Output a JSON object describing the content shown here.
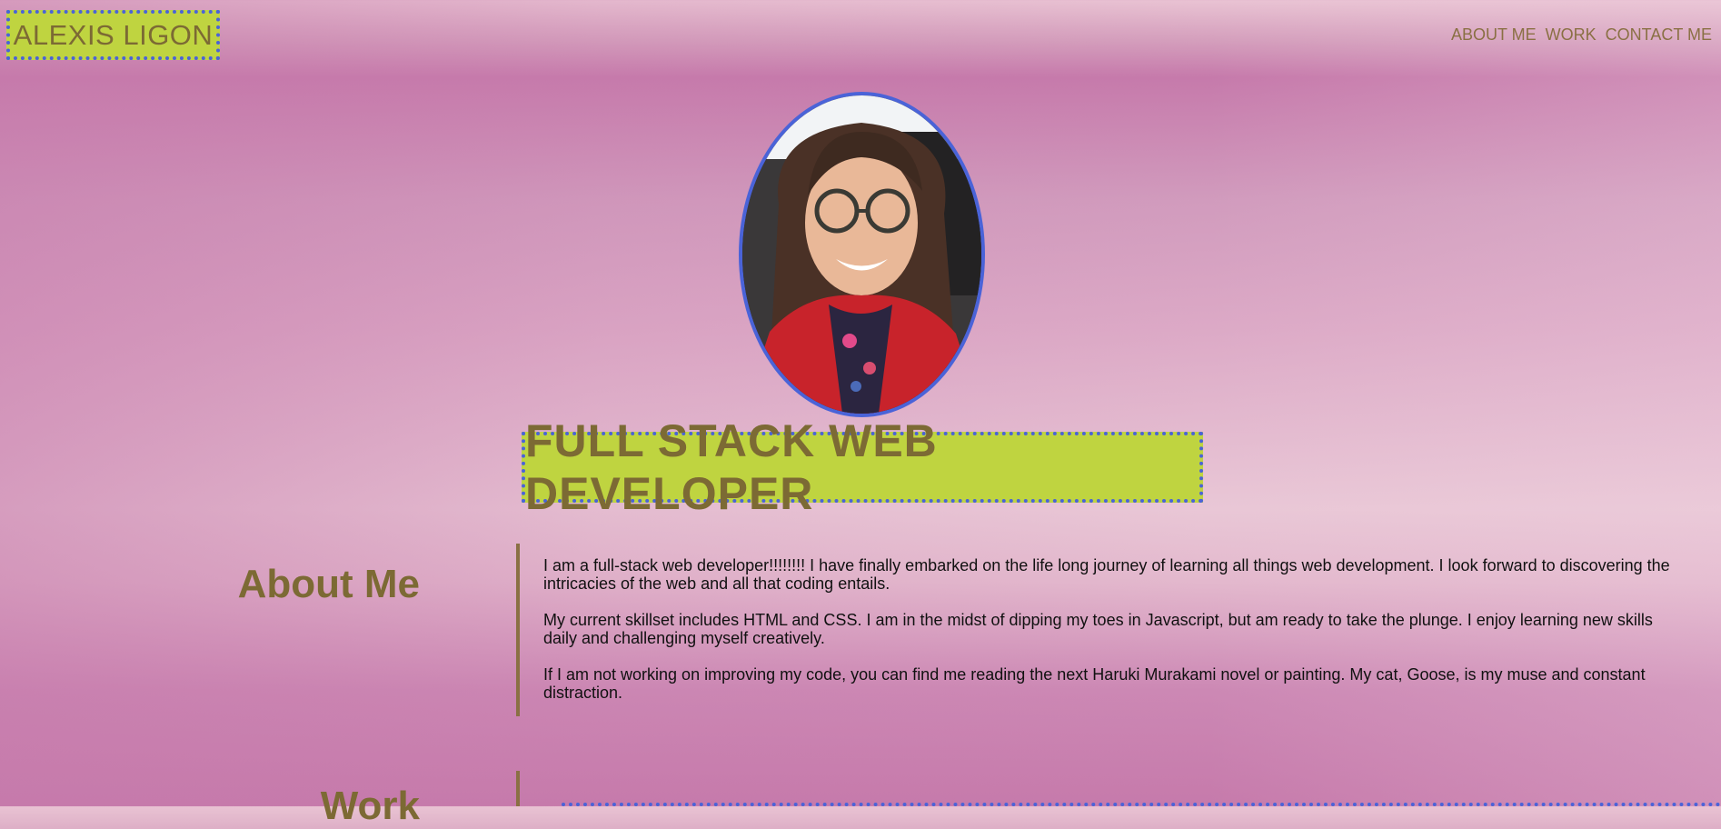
{
  "header": {
    "logo_text": "ALEXIS LIGON",
    "nav": [
      "ABOUT ME",
      "WORK",
      "CONTACT ME"
    ]
  },
  "hero": {
    "headline": "FULL STACK WEB DEVELOPER"
  },
  "about": {
    "title": "About Me",
    "paragraphs": [
      "I am a full-stack web developer!!!!!!!! I have finally embarked on the life long journey of learning all things web development. I look forward to discovering the intricacies of the web and all that coding entails.",
      "My current skillset includes HTML and CSS. I am in the midst of dipping my toes in Javascript, but am ready to take the plunge. I enjoy learning new skills daily and challenging myself creatively.",
      "If I am not working on improving my code, you can find me reading the next Haruki Murakami novel or painting. My cat, Goose, is my muse and constant distraction."
    ]
  },
  "work": {
    "title": "Work"
  },
  "colors": {
    "accent_green": "#bfd440",
    "dotted_border_blue": "#4a63d8",
    "heading_brown": "#7c6a34",
    "nav_brown": "#8a7044",
    "background_pink": "#d49ebc"
  },
  "icons": {
    "portrait": "profile-photo"
  }
}
